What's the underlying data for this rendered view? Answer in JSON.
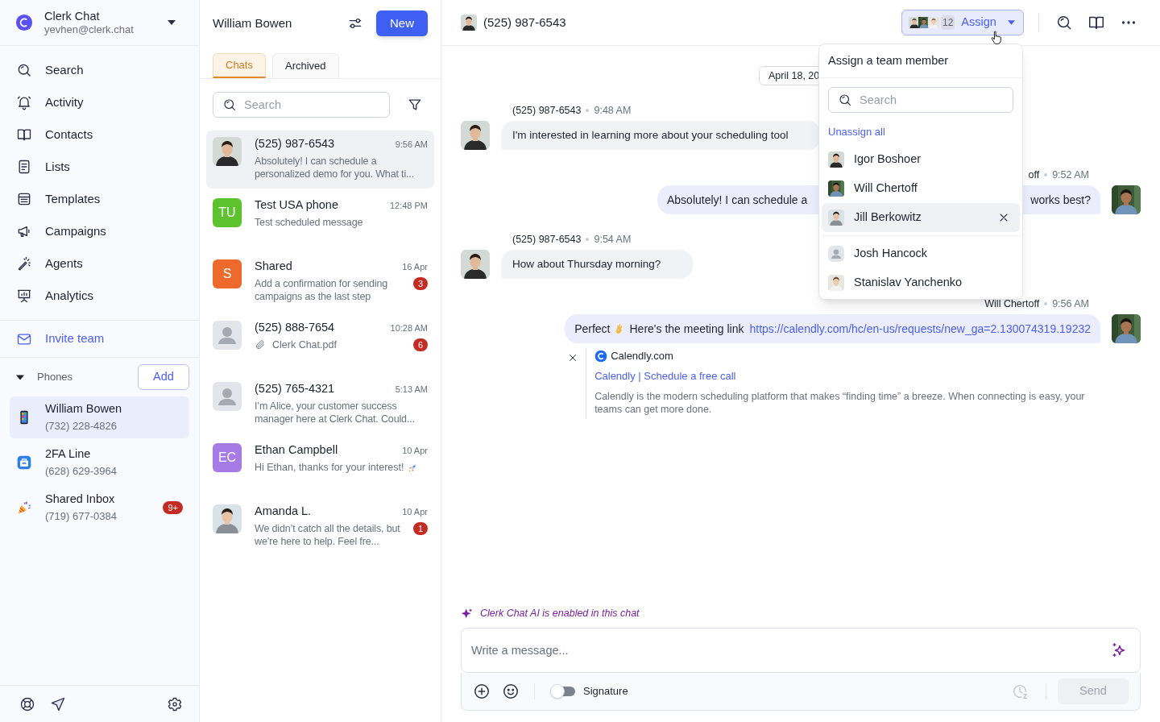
{
  "account": {
    "name": "Clerk Chat",
    "email": "yevhen@clerk.chat"
  },
  "nav": [
    {
      "label": "Search",
      "kind": "search"
    },
    {
      "label": "Activity",
      "kind": "bell"
    },
    {
      "label": "Contacts",
      "kind": "book"
    },
    {
      "label": "Lists",
      "kind": "doc"
    },
    {
      "label": "Templates",
      "kind": "template"
    },
    {
      "label": "Campaigns",
      "kind": "megaphone"
    },
    {
      "label": "Agents",
      "kind": "wand"
    },
    {
      "label": "Analytics",
      "kind": "board"
    }
  ],
  "invite": {
    "label": "Invite team"
  },
  "phones": {
    "label": "Phones",
    "expanded": true,
    "add_label": "Add",
    "items": [
      {
        "name": "William Bowen",
        "number": "(732) 228-4826",
        "selected": true,
        "kind": "mobile"
      },
      {
        "name": "2FA Line",
        "number": "(628) 629-3964",
        "selected": false,
        "kind": "app"
      },
      {
        "name": "Shared Inbox",
        "number": "(719) 677-0384",
        "selected": false,
        "kind": "party",
        "badge": "9+"
      }
    ]
  },
  "chat_list": {
    "title": "William Bowen",
    "new_label": "New",
    "tabs": [
      {
        "label": "Chats",
        "selected": true
      },
      {
        "label": "Archived",
        "selected": false
      }
    ],
    "search_placeholder": "Search",
    "items": [
      {
        "name": "(525) 987-6543",
        "time": "9:56 AM",
        "preview": "Absolutely! I can schedule a personalized demo for you. What ti...",
        "selected": true,
        "kind": "text"
      },
      {
        "name": "Test USA phone",
        "time": "12:48 PM",
        "preview": "Test scheduled message",
        "selected": false,
        "avatar": {
          "kind": "initials",
          "initials": "TU",
          "color": "#5cc22e"
        },
        "kind": "text"
      },
      {
        "name": "Shared",
        "time": "16 Apr",
        "preview": "Add a confirmation for sending campaigns as the last step",
        "selected": false,
        "avatar": {
          "kind": "initials",
          "initials": "S",
          "color": "#ee6a2c"
        },
        "kind": "text",
        "badge": "3"
      },
      {
        "name": "(525) 888-7654",
        "time": "10:28 AM",
        "preview": "Clerk Chat.pdf",
        "selected": false,
        "avatar": {
          "kind": "placeholder"
        },
        "kind": "attachment",
        "badge": "6"
      },
      {
        "name": "(525) 765-4321",
        "time": "5:13 AM",
        "preview": "I’m Alice, your customer success manager here at Clerk Chat. Could...",
        "selected": false,
        "avatar": {
          "kind": "placeholder"
        },
        "kind": "text"
      },
      {
        "name": "Ethan Campbell",
        "time": "10 Apr",
        "preview": "Hi Ethan, thanks for your interest!",
        "selected": false,
        "avatar": {
          "kind": "initials",
          "initials": "EC",
          "color": "#a77be6"
        },
        "kind": "emoji"
      },
      {
        "name": "Amanda L.",
        "time": "10 Apr",
        "preview": "We didn’t catch all the details, but we’re here to help. Feel fre...",
        "selected": false,
        "kind": "text",
        "badge": "1"
      }
    ]
  },
  "conversation": {
    "title": "(525) 987-6543",
    "assign": {
      "count": "12",
      "label": "Assign"
    },
    "date": "April 18, 20",
    "messages": [
      {
        "kind": "incoming",
        "sender": "(525) 987-6543",
        "time": "9:48 AM",
        "text": "I'm interested in learning more about your scheduling tool"
      },
      {
        "kind": "outgoing",
        "sender": "off",
        "time": "9:52 AM",
        "text": "Absolutely! I can schedule a",
        "text_end": "works best?"
      },
      {
        "kind": "incoming",
        "sender": "(525) 987-6543",
        "time": "9:54 AM",
        "text": "How about Thursday morning?"
      },
      {
        "kind": "outgoing",
        "sender": "Will Chertoff",
        "time": "9:56 AM",
        "text": "Perfect",
        "text_after_emoji": "Here's the meeting link",
        "link": "https://calendly.com/hc/en-us/requests/new_ga=2.130074319.19232",
        "preview": {
          "site": "Calendly.com",
          "title": "Calendly | Schedule a free call",
          "description": "Calendly is the modern scheduling platform that makes “finding time” a breeze. When connecting is easy, your teams can get more done."
        }
      }
    ]
  },
  "assign_menu": {
    "title": "Assign a team member",
    "search_placeholder": "Search",
    "unassign_label": "Unassign all",
    "assigned_members": [
      {
        "name": "Igor Boshoer",
        "selected": false
      },
      {
        "name": "Will Chertoff",
        "selected": false
      },
      {
        "name": "Jill Berkowitz",
        "selected": true
      }
    ],
    "other_members": [
      {
        "name": "Josh Hancock",
        "selected": false,
        "avatar": {
          "kind": "placeholder"
        }
      },
      {
        "name": "Stanislav Yanchenko",
        "selected": false
      }
    ]
  },
  "composer": {
    "ai_note": "Clerk Chat AI is enabled in this chat",
    "placeholder": "Write a message...",
    "signature": {
      "label": "Signature",
      "on": false
    },
    "send": {
      "label": "Send",
      "disabled": true
    }
  }
}
